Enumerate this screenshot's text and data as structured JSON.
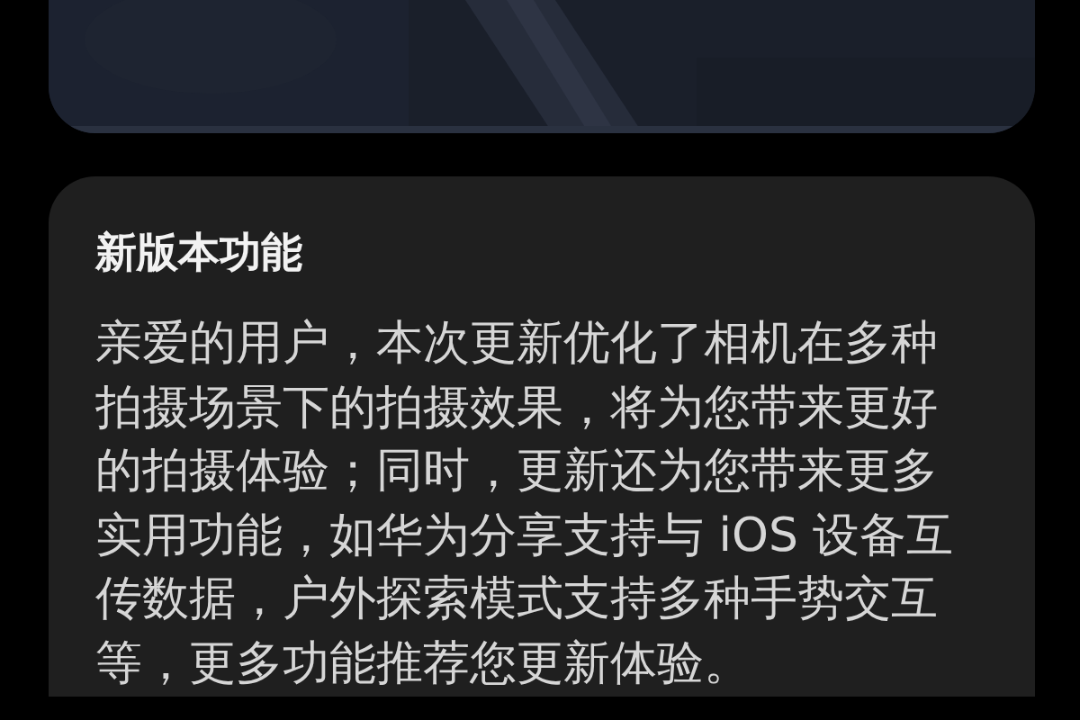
{
  "features_card": {
    "title": "新版本功能",
    "description": "亲爱的用户，本次更新优化了相机在多种拍摄场景下的拍摄效果，将为您带来更好的拍摄体验；同时，更新还为您带来更多实用功能，如华为分享支持与 iOS 设备互传数据，户外探索模式支持多种手势交互等，更多功能推荐您更新体验。"
  }
}
